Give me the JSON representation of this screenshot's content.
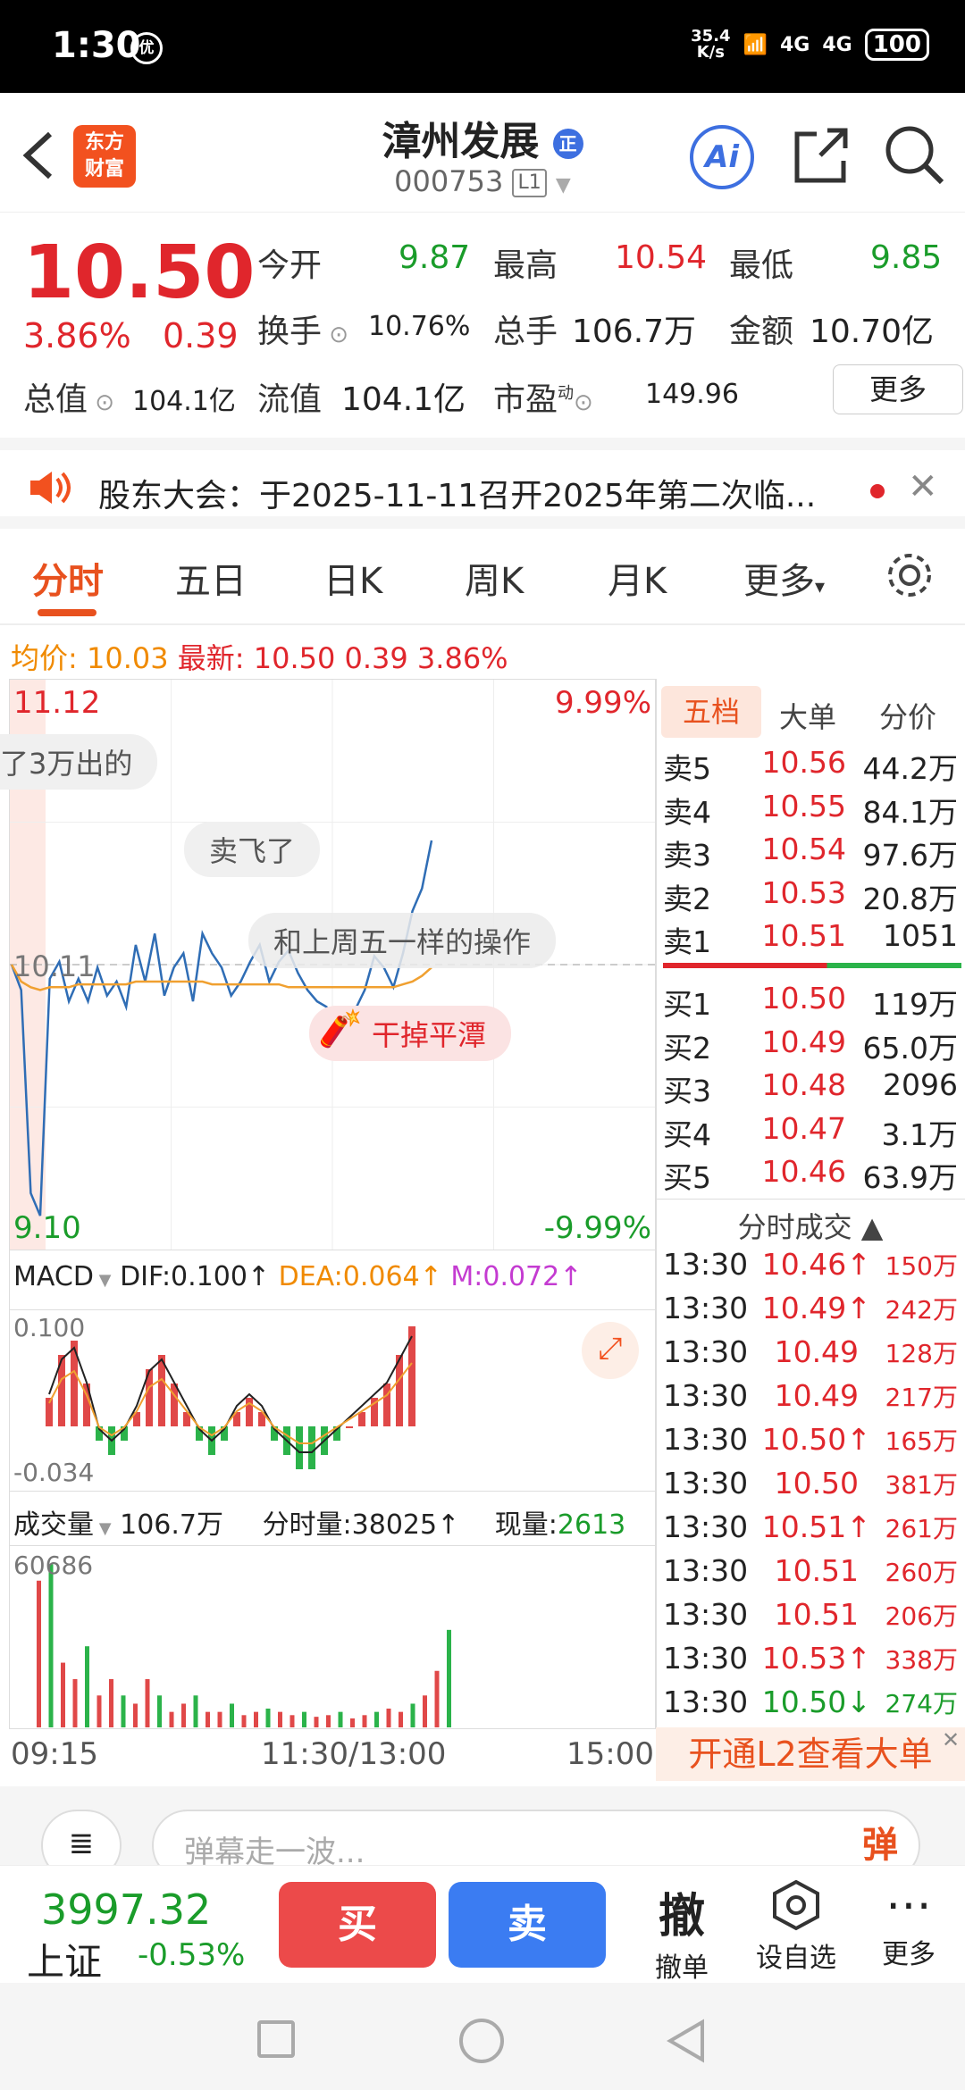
{
  "status": {
    "time": "1:30",
    "speed_top": "35.4",
    "speed_bottom": "K/s",
    "net1": "4G",
    "net2": "4G",
    "battery": "100"
  },
  "header": {
    "logo_line1": "东方",
    "logo_line2": "财富",
    "title": "漳州发展",
    "badge": "正",
    "code": "000753",
    "level": "L1",
    "ai": "Ai"
  },
  "quote": {
    "price": "10.50",
    "change_pct": "3.86%",
    "change": "0.39",
    "open_label": "今开",
    "open": "9.87",
    "high_label": "最高",
    "high": "10.54",
    "low_label": "最低",
    "low": "9.85",
    "turnover_label": "换手",
    "turnover": "10.76%",
    "volume_label": "总手",
    "volume": "106.7万",
    "amount_label": "金额",
    "amount": "10.70亿",
    "mktcap_label": "总值",
    "mktcap": "104.1亿",
    "float_label": "流值",
    "float": "104.1亿",
    "pe_label": "市盈",
    "pe_sup": "动",
    "pe": "149.96",
    "more": "更多"
  },
  "notice": {
    "text": "股东大会：于2025-11-11召开2025年第二次临..."
  },
  "tabs": [
    "分时",
    "五日",
    "日K",
    "周K",
    "月K",
    "更多"
  ],
  "avgline": {
    "avg_label": "均价:",
    "avg": "10.03",
    "last_label": "最新:",
    "last": "10.50",
    "chg": "0.39",
    "pct": "3.86%"
  },
  "chart_data": {
    "type": "line",
    "title": "",
    "y_max_label": "11.12",
    "y_min_label": "9.10",
    "y_max_pct": "9.99%",
    "y_min_pct": "-9.99%",
    "ref_price": "10.11",
    "ylim": [
      9.1,
      11.12
    ],
    "x_ticks": [
      "09:15",
      "11:30/13:00",
      "15:00"
    ],
    "series": [
      {
        "values": [
          10.11,
          10.02,
          9.3,
          9.22,
          10.06,
          10.12,
          9.98,
          10.06,
          9.98,
          10.1,
          10.0,
          10.05,
          9.96,
          10.18,
          10.05,
          10.22,
          10.0,
          10.1,
          10.15,
          9.98,
          10.22,
          10.15,
          10.1,
          10.0,
          10.05,
          10.12,
          10.18,
          10.05,
          10.12,
          10.16,
          10.08,
          10.02,
          9.98,
          9.96,
          9.92,
          9.96,
          9.95,
          10.02,
          10.14,
          10.1,
          10.03,
          10.15,
          10.3,
          10.38,
          10.55
        ]
      },
      {
        "values": [
          10.11,
          10.05,
          10.03,
          10.02,
          10.03,
          10.03,
          10.03,
          10.04,
          10.04,
          10.04,
          10.04,
          10.04,
          10.04,
          10.05,
          10.05,
          10.05,
          10.05,
          10.05,
          10.05,
          10.05,
          10.05,
          10.04,
          10.04,
          10.04,
          10.04,
          10.04,
          10.04,
          10.04,
          10.04,
          10.03,
          10.03,
          10.03,
          10.03,
          10.03,
          10.03,
          10.03,
          10.03,
          10.03,
          10.03,
          10.03,
          10.03,
          10.04,
          10.05,
          10.07,
          10.1
        ]
      }
    ],
    "macd": {
      "label": "MACD",
      "dif": "DIF:0.100↑",
      "dea": "DEA:0.064↑",
      "m": "M:0.072↑",
      "top": "0.100",
      "bottom": "-0.034",
      "bars": [
        0.02,
        0.05,
        0.06,
        0.03,
        -0.01,
        -0.02,
        -0.01,
        0.01,
        0.04,
        0.05,
        0.03,
        0.01,
        -0.01,
        -0.02,
        -0.01,
        0.01,
        0.02,
        0.01,
        -0.01,
        -0.02,
        -0.03,
        -0.03,
        -0.02,
        -0.01,
        0,
        0.01,
        0.02,
        0.03,
        0.05,
        0.07
      ]
    },
    "volume": {
      "label": "成交量",
      "total": "106.7万",
      "tick_label": "分时量:",
      "tick": "38025↑",
      "now_label": "现量:",
      "now": "2613",
      "top": "60686",
      "bars": [
        0.9,
        1.0,
        0.4,
        0.3,
        0.5,
        0.2,
        0.3,
        0.2,
        0.15,
        0.3,
        0.2,
        0.1,
        0.15,
        0.2,
        0.1,
        0.1,
        0.15,
        0.08,
        0.1,
        0.12,
        0.1,
        0.08,
        0.1,
        0.07,
        0.08,
        0.1,
        0.06,
        0.08,
        0.1,
        0.12,
        0.1,
        0.15,
        0.2,
        0.35,
        0.6
      ]
    }
  },
  "annotations": [
    "了3万出的",
    "卖飞了",
    "和上周五一样的操作",
    "干掉平潭"
  ],
  "orderbook": {
    "tabs": [
      "五档",
      "大单",
      "分价"
    ],
    "asks": [
      [
        "卖5",
        "10.56",
        "44.2万"
      ],
      [
        "卖4",
        "10.55",
        "84.1万"
      ],
      [
        "卖3",
        "10.54",
        "97.6万"
      ],
      [
        "卖2",
        "10.53",
        "20.8万"
      ],
      [
        "卖1",
        "10.51",
        "1051"
      ]
    ],
    "bids": [
      [
        "买1",
        "10.50",
        "119万"
      ],
      [
        "买2",
        "10.49",
        "65.0万"
      ],
      [
        "买3",
        "10.48",
        "2096"
      ],
      [
        "买4",
        "10.47",
        "3.1万"
      ],
      [
        "买5",
        "10.46",
        "63.9万"
      ]
    ]
  },
  "trades": {
    "title": "分时成交",
    "rows": [
      [
        "13:30",
        "10.46↑",
        "150万"
      ],
      [
        "13:30",
        "10.49↑",
        "242万"
      ],
      [
        "13:30",
        "10.49",
        "128万"
      ],
      [
        "13:30",
        "10.49",
        "217万"
      ],
      [
        "13:30",
        "10.50↑",
        "165万"
      ],
      [
        "13:30",
        "10.50",
        "381万"
      ],
      [
        "13:30",
        "10.51↑",
        "261万"
      ],
      [
        "13:30",
        "10.51",
        "260万"
      ],
      [
        "13:30",
        "10.51",
        "206万"
      ],
      [
        "13:30",
        "10.53↑",
        "338万"
      ],
      [
        "13:30",
        "10.50↓",
        "274万"
      ]
    ]
  },
  "l2_promo": "开通L2查看大单",
  "danmu": {
    "placeholder": "弹幕走一波...",
    "btn": "弹"
  },
  "bottom": {
    "index_value": "3997.32",
    "index_name": "上证",
    "index_change": "-0.53%",
    "buy": "买",
    "sell": "卖",
    "cancel_icon": "撤",
    "cancel": "撤单",
    "watch": "设自选",
    "more": "更多"
  }
}
